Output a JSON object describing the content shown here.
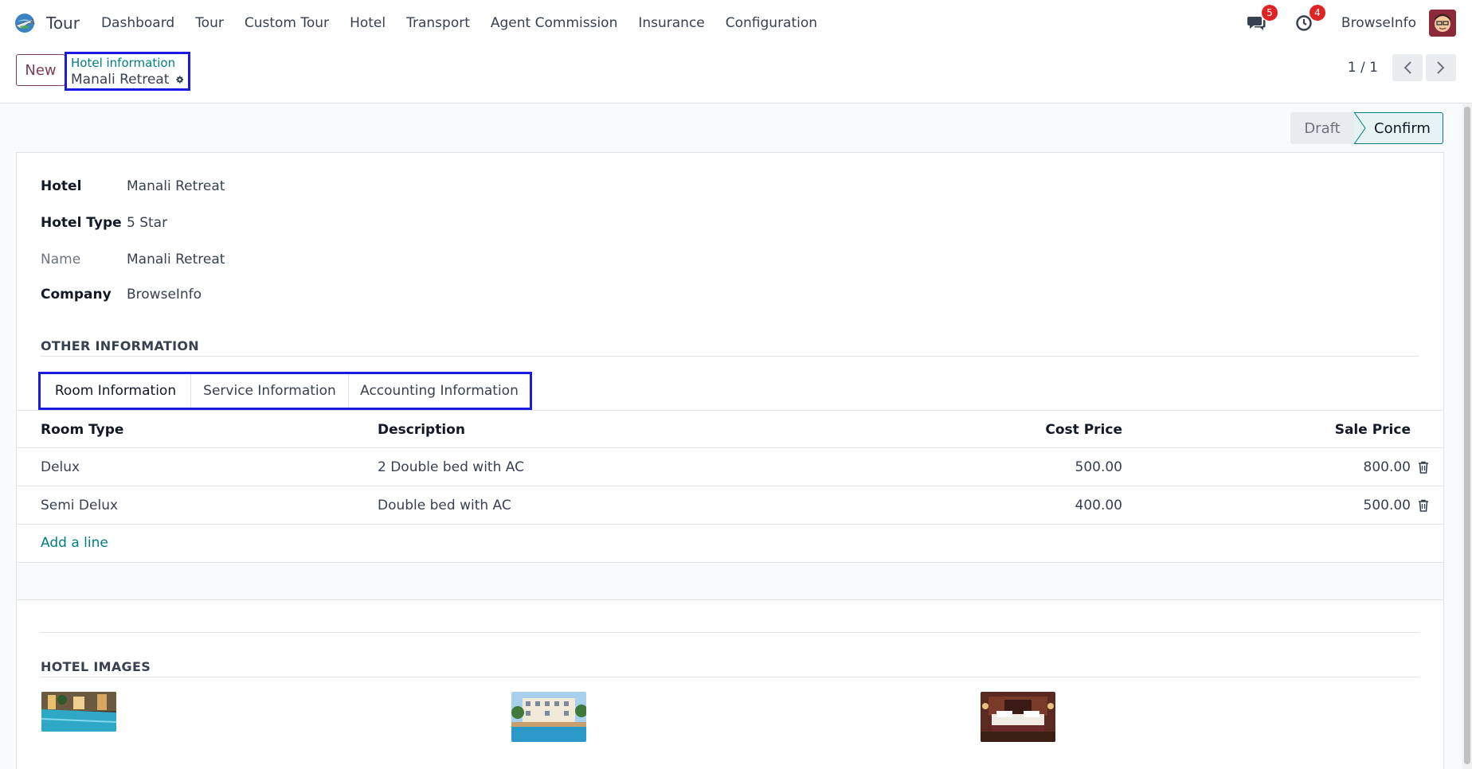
{
  "navbar": {
    "app_name": "Tour",
    "menu": [
      "Dashboard",
      "Tour",
      "Custom Tour",
      "Hotel",
      "Transport",
      "Agent Commission",
      "Insurance",
      "Configuration"
    ],
    "messages_count": "5",
    "activities_count": "4",
    "user_name": "BrowseInfo"
  },
  "control": {
    "new_label": "New",
    "breadcrumb_parent": "Hotel information",
    "breadcrumb_current": "Manali Retreat",
    "pager": "1 / 1"
  },
  "status": {
    "stages": [
      "Draft",
      "Confirm"
    ],
    "active": "Confirm"
  },
  "form": {
    "hotel_label": "Hotel",
    "hotel_value": "Manali Retreat",
    "type_label": "Hotel Type",
    "type_value": "5 Star",
    "name_label": "Name",
    "name_value": "Manali Retreat",
    "company_label": "Company",
    "company_value": "BrowseInfo"
  },
  "other_info": {
    "title": "OTHER INFORMATION",
    "tabs": [
      "Room Information",
      "Service Information",
      "Accounting Information"
    ],
    "active_tab": "Room Information",
    "table": {
      "headers": [
        "Room Type",
        "Description",
        "Cost Price",
        "Sale Price"
      ],
      "rows": [
        {
          "room_type": "Delux",
          "description": "2 Double bed with AC",
          "cost": "500.00",
          "sale": "800.00"
        },
        {
          "room_type": "Semi Delux",
          "description": "Double bed with AC",
          "cost": "400.00",
          "sale": "500.00"
        }
      ],
      "add_line": "Add a line"
    }
  },
  "images": {
    "title": "HOTEL IMAGES"
  },
  "colors": {
    "accent": "#017e84",
    "primary_btn": "#7b3c57",
    "highlight": "#1a1ae0",
    "badge": "#e02424"
  }
}
